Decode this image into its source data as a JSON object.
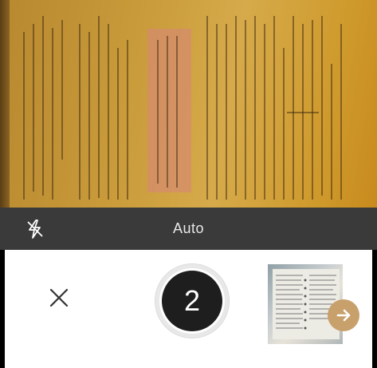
{
  "mode_bar": {
    "mode_label": "Auto"
  },
  "capture": {
    "page_count": "2"
  },
  "icons": {
    "flash": "flash-auto-icon",
    "close": "close-icon",
    "next": "arrow-right-icon"
  },
  "colors": {
    "mode_bar_bg": "#3a3a3a",
    "shutter_inner": "#1e1e1e",
    "next_button": "#c8a06b"
  }
}
